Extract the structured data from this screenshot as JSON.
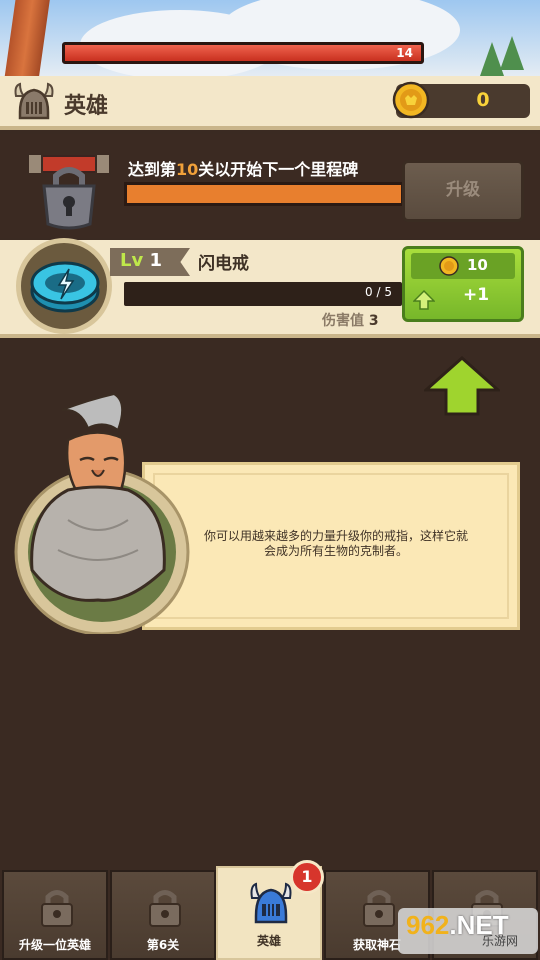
{
  "top_bar": {
    "hp_value": "14"
  },
  "header": {
    "title": "英雄",
    "title_icon": "viking-helmet-icon",
    "coins": "0",
    "coin_icon": "gold-coin-icon"
  },
  "milestone": {
    "text_prefix": "达到第",
    "level": "10",
    "text_suffix": "关以开始下一个里程碑",
    "upgrade_label": "升级",
    "lock_icon": "lock-icon"
  },
  "item": {
    "icon": "lightning-ring-icon",
    "lv_prefix": "Lv",
    "level": "1",
    "name": "闪电戒",
    "progress": "0 / 5",
    "progress_fraction": 0,
    "damage_label": "伤害值",
    "damage_value": "3",
    "buy_cost": "10",
    "buy_gain": "+1"
  },
  "dialog": {
    "text": "你可以用越来越多的力量升级你的戒指，这样它就会成为所有生物的克制者。"
  },
  "bottom_nav": {
    "tabs": [
      {
        "label": "升级一位英雄",
        "icon": "lock-icon",
        "active": false
      },
      {
        "label": "第6关",
        "icon": "lock-icon",
        "active": false
      },
      {
        "label": "英雄",
        "icon": "viking-helmet-icon",
        "active": true,
        "badge": "1"
      },
      {
        "label": "获取神石",
        "icon": "lock-icon",
        "active": false
      },
      {
        "label": "",
        "icon": "lock-icon",
        "active": false
      }
    ]
  },
  "watermark": {
    "main": "962",
    "main_suffix": ".NET",
    "sub": "乐游网"
  },
  "colors": {
    "accent_orange": "#f0a03a",
    "buy_green": "#8ccd32",
    "hp_red": "#d83a28",
    "coin_gold": "#f8d23a",
    "badge_red": "#d7352c"
  }
}
